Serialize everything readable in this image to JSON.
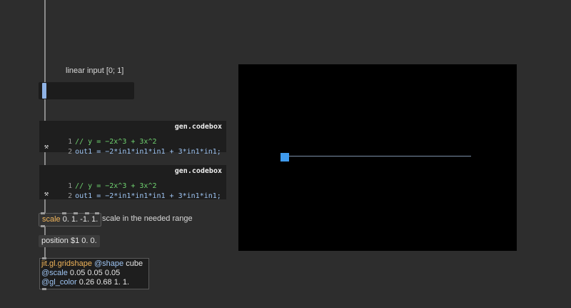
{
  "comments": {
    "input_label": "linear input [0; 1]",
    "scale_label": "scale in the needed range"
  },
  "slider": {
    "value": 0.0
  },
  "codeboxes": [
    {
      "title": "gen.codebox",
      "lines": [
        {
          "num": "1",
          "text": "// y = −2x^3 + 3x^2"
        },
        {
          "num": "2",
          "text": "out1 = −2*in1*in1*in1 + 3*in1*in1;"
        }
      ],
      "hammer": "⚒"
    },
    {
      "title": "gen.codebox",
      "lines": [
        {
          "num": "1",
          "text": "// y = −2x^3 + 3x^2"
        },
        {
          "num": "2",
          "text": "out1 = −2*in1*in1*in1 + 3*in1*in1;"
        }
      ],
      "hammer": "⚒"
    }
  ],
  "scale_object": {
    "name": "scale",
    "args": "0. 1. -1. 1."
  },
  "position_message": {
    "text": "position $1 0. 0."
  },
  "gridshape": {
    "name": "jit.gl.gridshape",
    "attr1": "@shape",
    "val1": "cube",
    "attr2": "@scale",
    "val2": "0.05 0.05 0.05",
    "attr3": "@gl_color",
    "val3": "0.26 0.68 1. 1."
  },
  "render_window": {
    "cube_color": "#3f9bee",
    "position": 0.0
  }
}
